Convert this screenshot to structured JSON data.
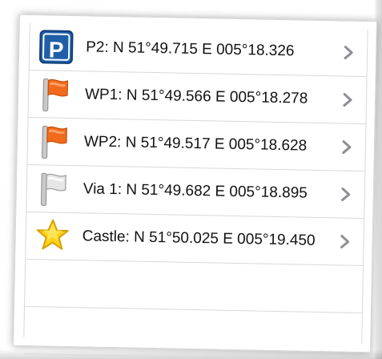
{
  "waypoints": [
    {
      "icon": "parking-icon",
      "label": "P2: N 51°49.715 E 005°18.326"
    },
    {
      "icon": "orange-flag-icon",
      "label": "WP1: N 51°49.566 E 005°18.278"
    },
    {
      "icon": "orange-flag-icon",
      "label": "WP2: N 51°49.517 E 005°18.628"
    },
    {
      "icon": "gray-flag-icon",
      "label": "Via 1: N 51°49.682 E 005°18.895"
    },
    {
      "icon": "star-icon",
      "label": "Castle: N 51°50.025 E 005°19.450"
    }
  ],
  "colors": {
    "parking_blue": "#1f5fa8",
    "flag_orange": "#f26b1d",
    "flag_gray": "#d6d6d6",
    "star_yellow": "#ffd21a",
    "chevron": "#8e8e93",
    "separator": "#d9d9d9"
  }
}
